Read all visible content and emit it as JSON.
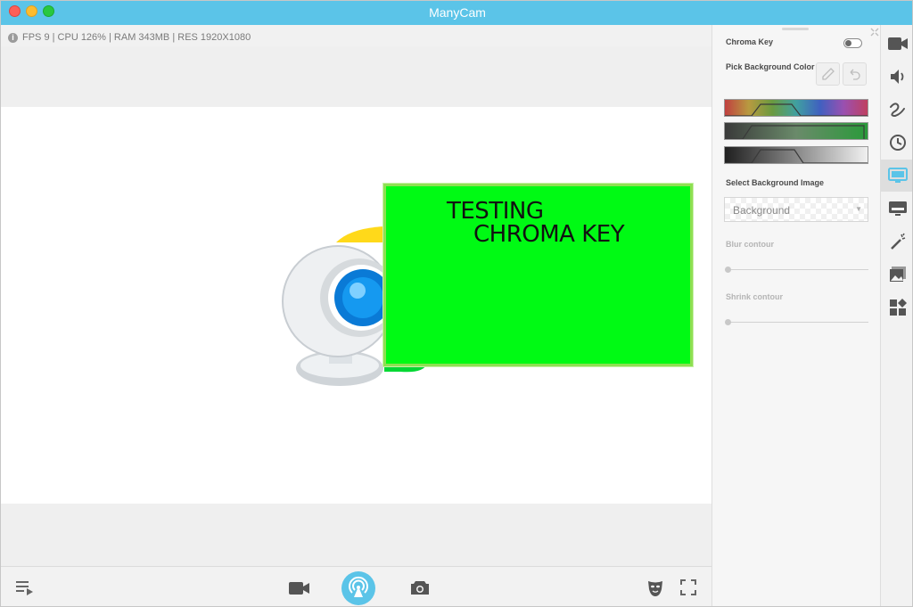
{
  "window": {
    "title": "ManyCam"
  },
  "status": {
    "text": "FPS 9 | CPU 126% | RAM 343MB | RES 1920X1080"
  },
  "preview": {
    "overlay_line1": "TESTING",
    "overlay_line2": "CHROMA KEY",
    "overlay_color": "#00fa14"
  },
  "chroma": {
    "title": "Chroma Key",
    "enabled": false,
    "pick_label": "Pick Background Color",
    "select_bg_label": "Select Background Image",
    "bg_value": "Background",
    "blur_label": "Blur contour",
    "shrink_label": "Shrink contour"
  },
  "rail": {
    "items": [
      "video-camera-icon",
      "speaker-icon",
      "draw-icon",
      "clock-icon",
      "chroma-key-icon",
      "lower-third-icon",
      "magic-wand-icon",
      "images-icon",
      "widgets-icon"
    ],
    "active": "chroma-key-icon"
  },
  "bottom": {
    "icons": [
      "playlist-icon",
      "record-video-icon",
      "broadcast-icon",
      "snapshot-icon",
      "mask-icon",
      "fullscreen-icon"
    ]
  },
  "colors": {
    "accent": "#5bc4e8"
  }
}
